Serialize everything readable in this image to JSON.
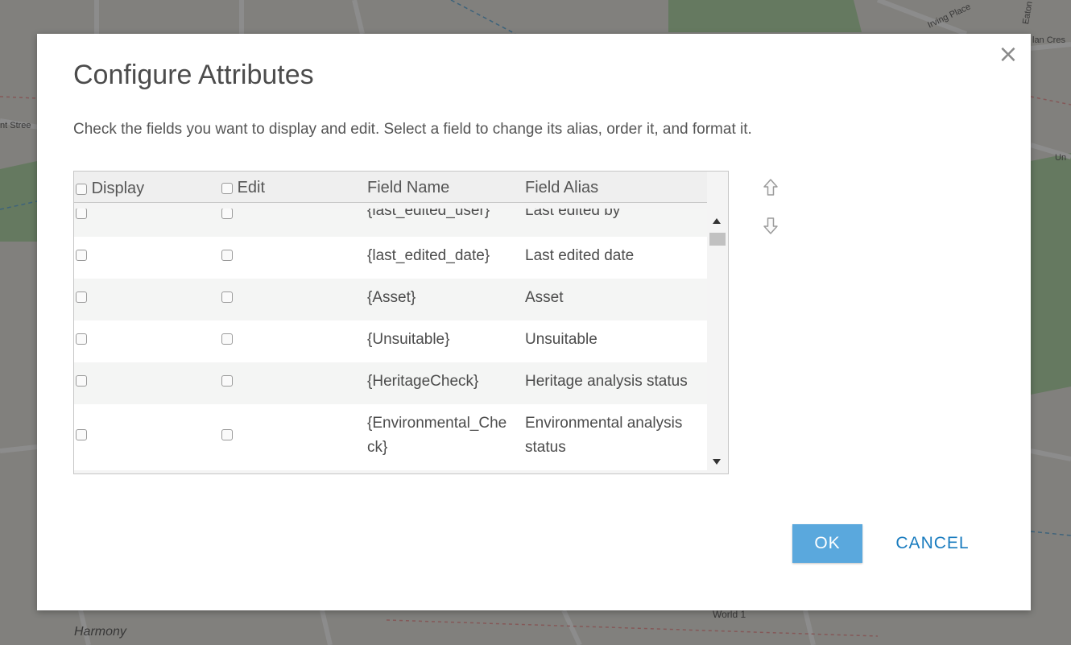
{
  "map": {
    "labels": {
      "harmony": "Harmony",
      "world": "World 1",
      "irving": "Irving Place",
      "eaton": "Eaton",
      "lan_cres": "lan Cres",
      "street_left": "nt Stree",
      "un": "Un"
    }
  },
  "dialog": {
    "title": "Configure Attributes",
    "close_symbol": "×",
    "instructions": "Check the fields you want to display and edit. Select a field to change its alias, order it, and format it."
  },
  "table": {
    "headers": {
      "display": "Display",
      "edit": "Edit",
      "field_name": "Field Name",
      "field_alias": "Field Alias"
    },
    "rows": [
      {
        "field_name": "{last_edited_user}",
        "field_alias": "Last edited by",
        "display": false,
        "edit": false
      },
      {
        "field_name": "{last_edited_date}",
        "field_alias": "Last edited date",
        "display": false,
        "edit": false
      },
      {
        "field_name": "{Asset}",
        "field_alias": "Asset",
        "display": false,
        "edit": false
      },
      {
        "field_name": "{Unsuitable}",
        "field_alias": "Unsuitable",
        "display": false,
        "edit": false
      },
      {
        "field_name": "{HeritageCheck}",
        "field_alias": "Heritage analysis status",
        "display": false,
        "edit": false
      },
      {
        "field_name_line1": "{Environmental_Che",
        "field_name_line2": "ck}",
        "field_alias_line1": "Environmental analysis",
        "field_alias_line2": "status",
        "display": false,
        "edit": false
      }
    ]
  },
  "icons": {
    "close": "close-icon",
    "move_up": "arrow-up-icon",
    "move_down": "arrow-down-icon",
    "scroll_up": "scroll-up-arrow-icon",
    "scroll_down": "scroll-down-arrow-icon"
  },
  "buttons": {
    "ok_label": "OK",
    "cancel_label": "CANCEL"
  },
  "colors": {
    "ok_bg": "#5aa8dd",
    "cancel_text": "#1a7cbf",
    "overlay": "rgba(0,0,0,0.45)"
  }
}
